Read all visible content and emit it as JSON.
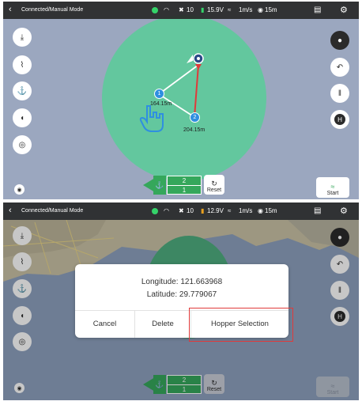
{
  "status_bar": {
    "back_icon": "chevron-left-icon",
    "mode_text": "Connected/Manual Mode",
    "satellites": "10",
    "speed": "1m/s",
    "distance": "15m"
  },
  "screen1": {
    "battery": "15.9V",
    "point_labels": {
      "p1": "1",
      "p2": "2"
    },
    "segment_label_a": "164.15m",
    "segment_label_b": "204.15m",
    "route_panel": {
      "top": "2",
      "bottom": "1"
    },
    "reset_label": "Reset",
    "start_label": "Start"
  },
  "screen2": {
    "battery": "12.9V",
    "dialog": {
      "longitude": "Longitude: 121.663968",
      "latitude": "Latitude: 29.779067",
      "cancel": "Cancel",
      "delete": "Delete",
      "hopper": "Hopper Selection"
    },
    "route_panel": {
      "top": "2",
      "bottom": "1"
    },
    "reset_label": "Reset",
    "start_label": "Start"
  },
  "colors": {
    "circle": "#63c79e",
    "route_white": "#ffffff",
    "route_red": "#e03a3a",
    "point_blue": "#2f8fe0",
    "highlight_red": "#e03a3a"
  }
}
